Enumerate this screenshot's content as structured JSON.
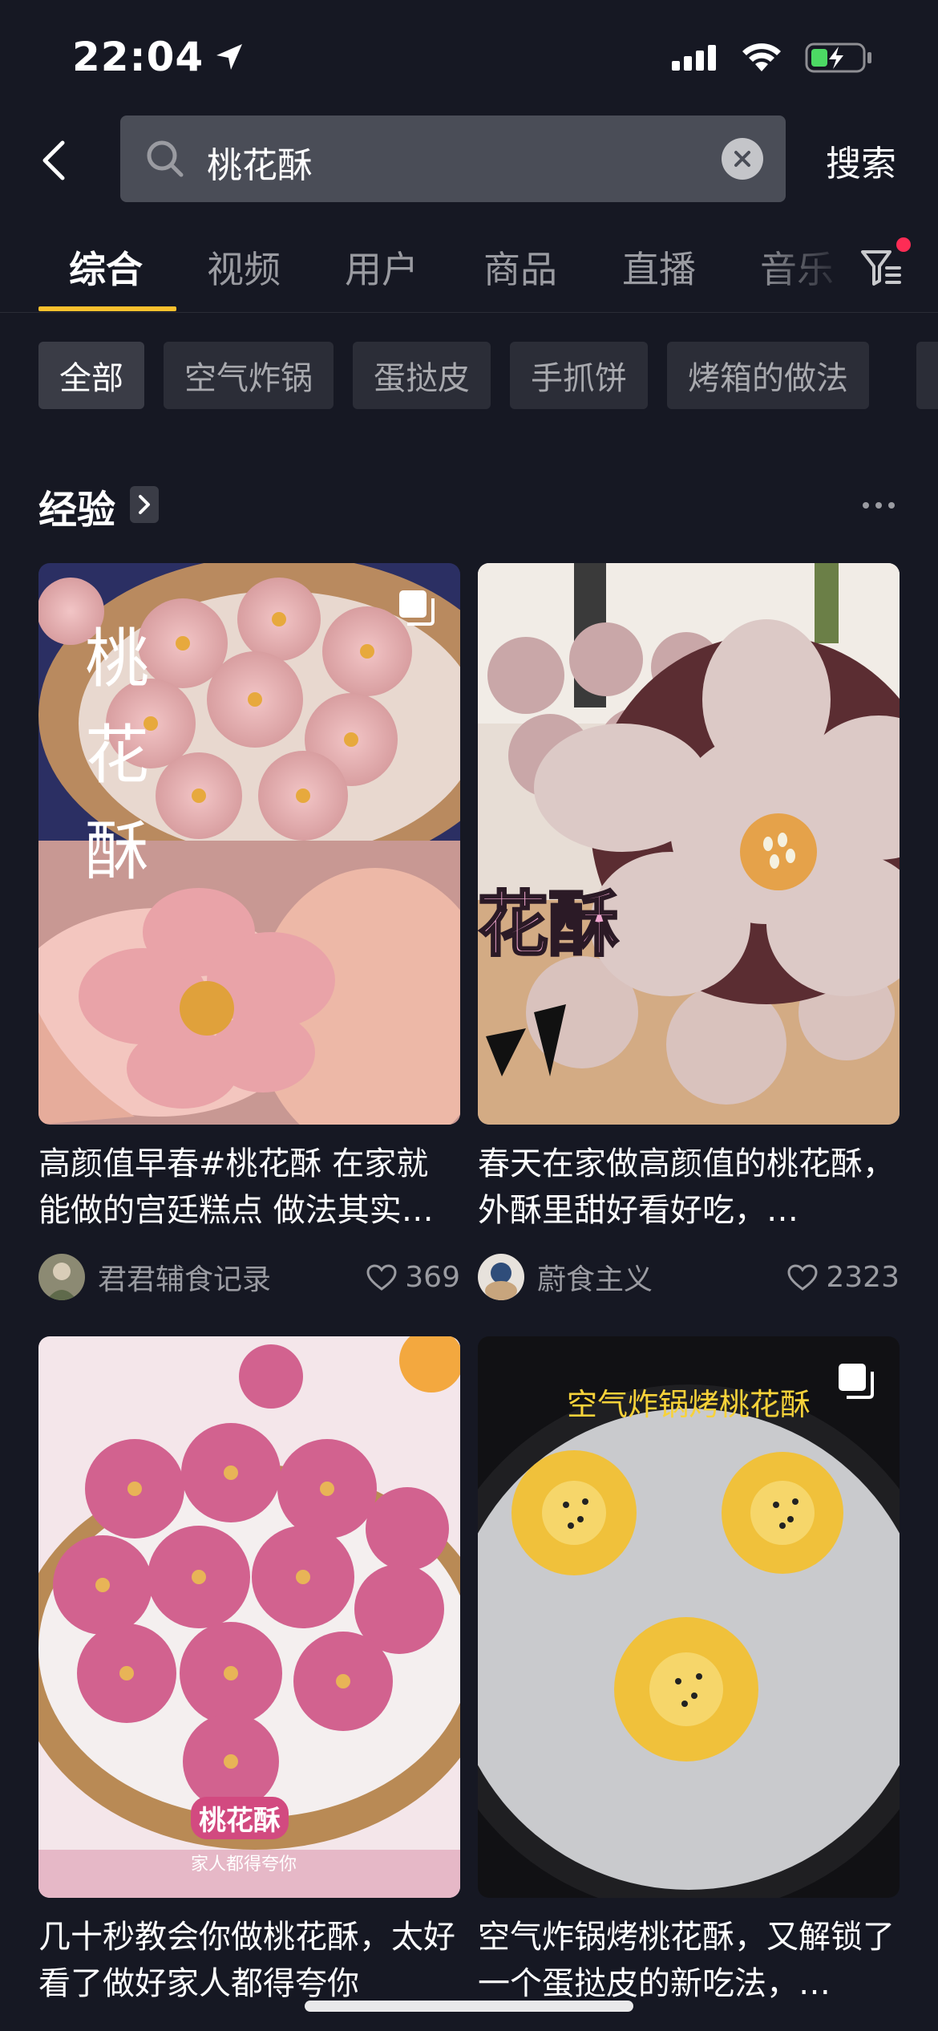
{
  "status_bar": {
    "time": "22:04"
  },
  "search": {
    "query": "桃花酥",
    "submit_label": "搜索"
  },
  "tabs": [
    "综合",
    "视频",
    "用户",
    "商品",
    "直播",
    "音乐"
  ],
  "chips": [
    "全部",
    "空气炸锅",
    "蛋挞皮",
    "手抓饼",
    "烤箱的做法"
  ],
  "section": {
    "title": "经验"
  },
  "cards": [
    {
      "title": "高颜值早春#桃花酥 在家就能做的宫廷糕点 做法其实…",
      "author": "君君辅食记录",
      "likes": "369",
      "overlay": [
        "桃",
        "花",
        "酥"
      ]
    },
    {
      "title": "春天在家做高颜值的桃花酥，外酥里甜好看好吃，…",
      "author": "蔚食主义",
      "likes": "2323",
      "overlay": "花酥"
    },
    {
      "title": "几十秒教会你做桃花酥，太好看了做好家人都得夸你",
      "overlay": "桃花酥",
      "overlay_sub": "家人都得夸你"
    },
    {
      "title": "空气炸锅烤桃花酥，又解锁了一个蛋挞皮的新吃法，…",
      "overlay": "空气炸锅烤桃花酥"
    }
  ],
  "colors": {
    "background": "#161823",
    "tab_indicator": "#fbc02d",
    "badge": "#fe2c55",
    "battery": "#4cd964"
  }
}
